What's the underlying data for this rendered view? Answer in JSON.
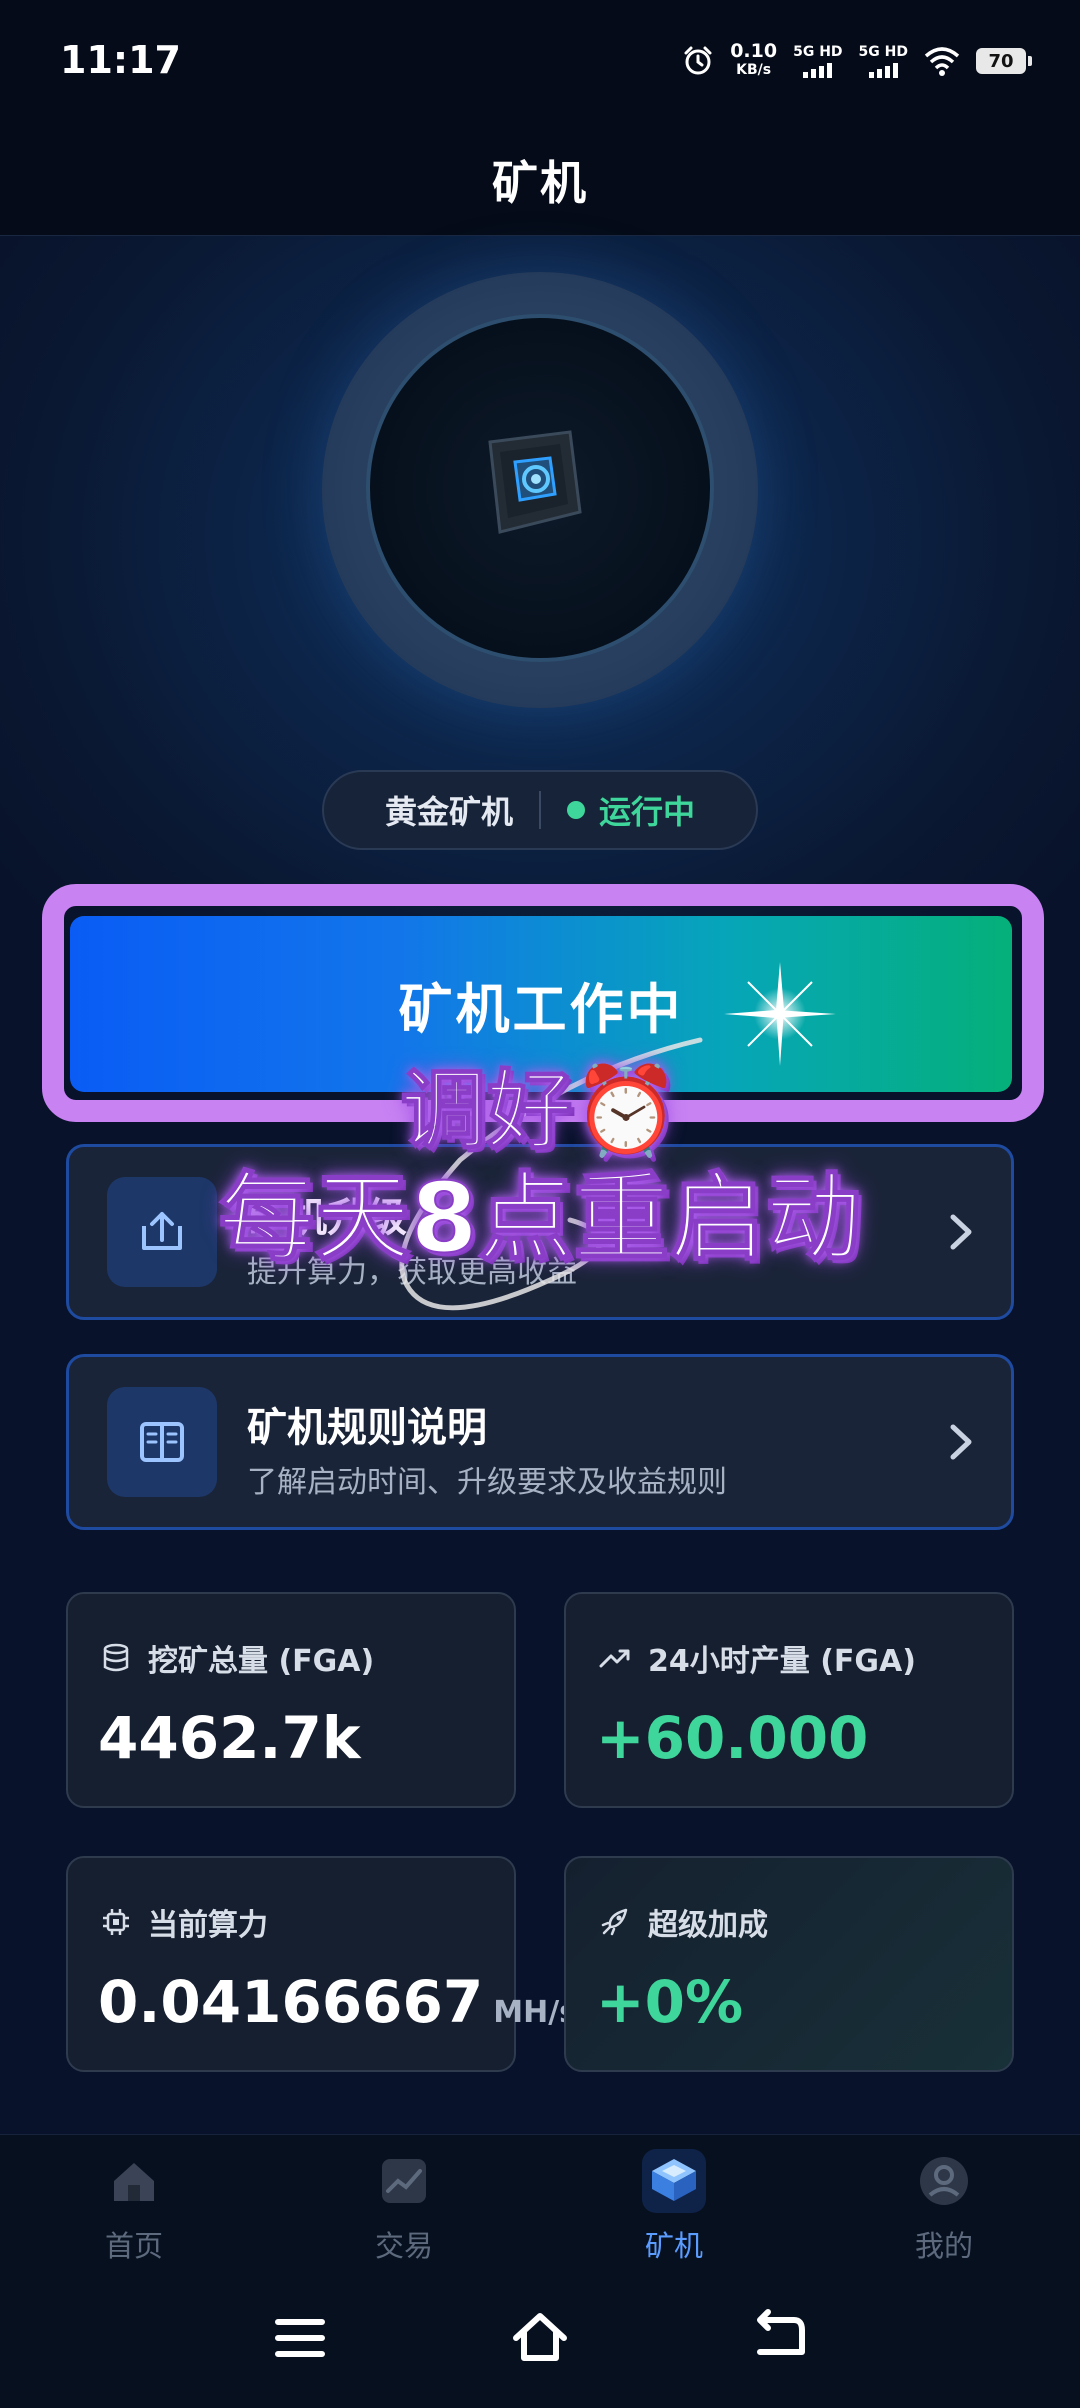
{
  "status_bar": {
    "time": "11:17",
    "net_speed_value": "0.10",
    "net_speed_unit": "KB/s",
    "signal1_label": "5G HD",
    "signal2_label": "5G HD",
    "battery": "70"
  },
  "header": {
    "title": "矿机"
  },
  "miner": {
    "name": "黄金矿机",
    "status": "运行中",
    "status_color": "#3ed69a"
  },
  "work_button": {
    "label": "矿机工作中"
  },
  "overlay": {
    "line1": "调好⏰",
    "line2": "每天8点重启动"
  },
  "features": [
    {
      "title": "矿机升级",
      "subtitle": "提升算力，获取更高收益",
      "icon": "upload-icon"
    },
    {
      "title": "矿机规则说明",
      "subtitle": "了解启动时间、升级要求及收益规则",
      "icon": "book-icon"
    }
  ],
  "stats": [
    {
      "label": "挖矿总量 (FGA)",
      "value": "4462.7k",
      "icon": "database-icon"
    },
    {
      "label": "24小时产量 (FGA)",
      "value": "+60.000",
      "icon": "trend-up-icon"
    },
    {
      "label": "当前算力",
      "value": "0.04166667",
      "unit": "MH/s",
      "icon": "chip-icon"
    },
    {
      "label": "超级加成",
      "value": "+0%",
      "icon": "rocket-icon"
    }
  ],
  "tabs": [
    {
      "label": "首页",
      "icon": "home-icon"
    },
    {
      "label": "交易",
      "icon": "chart-icon"
    },
    {
      "label": "矿机",
      "icon": "miner-icon",
      "active": true
    },
    {
      "label": "我的",
      "icon": "profile-icon"
    }
  ],
  "colors": {
    "accent_green": "#3ed69a",
    "accent_blue": "#5a9cff",
    "highlight_purple": "#c882f2"
  }
}
